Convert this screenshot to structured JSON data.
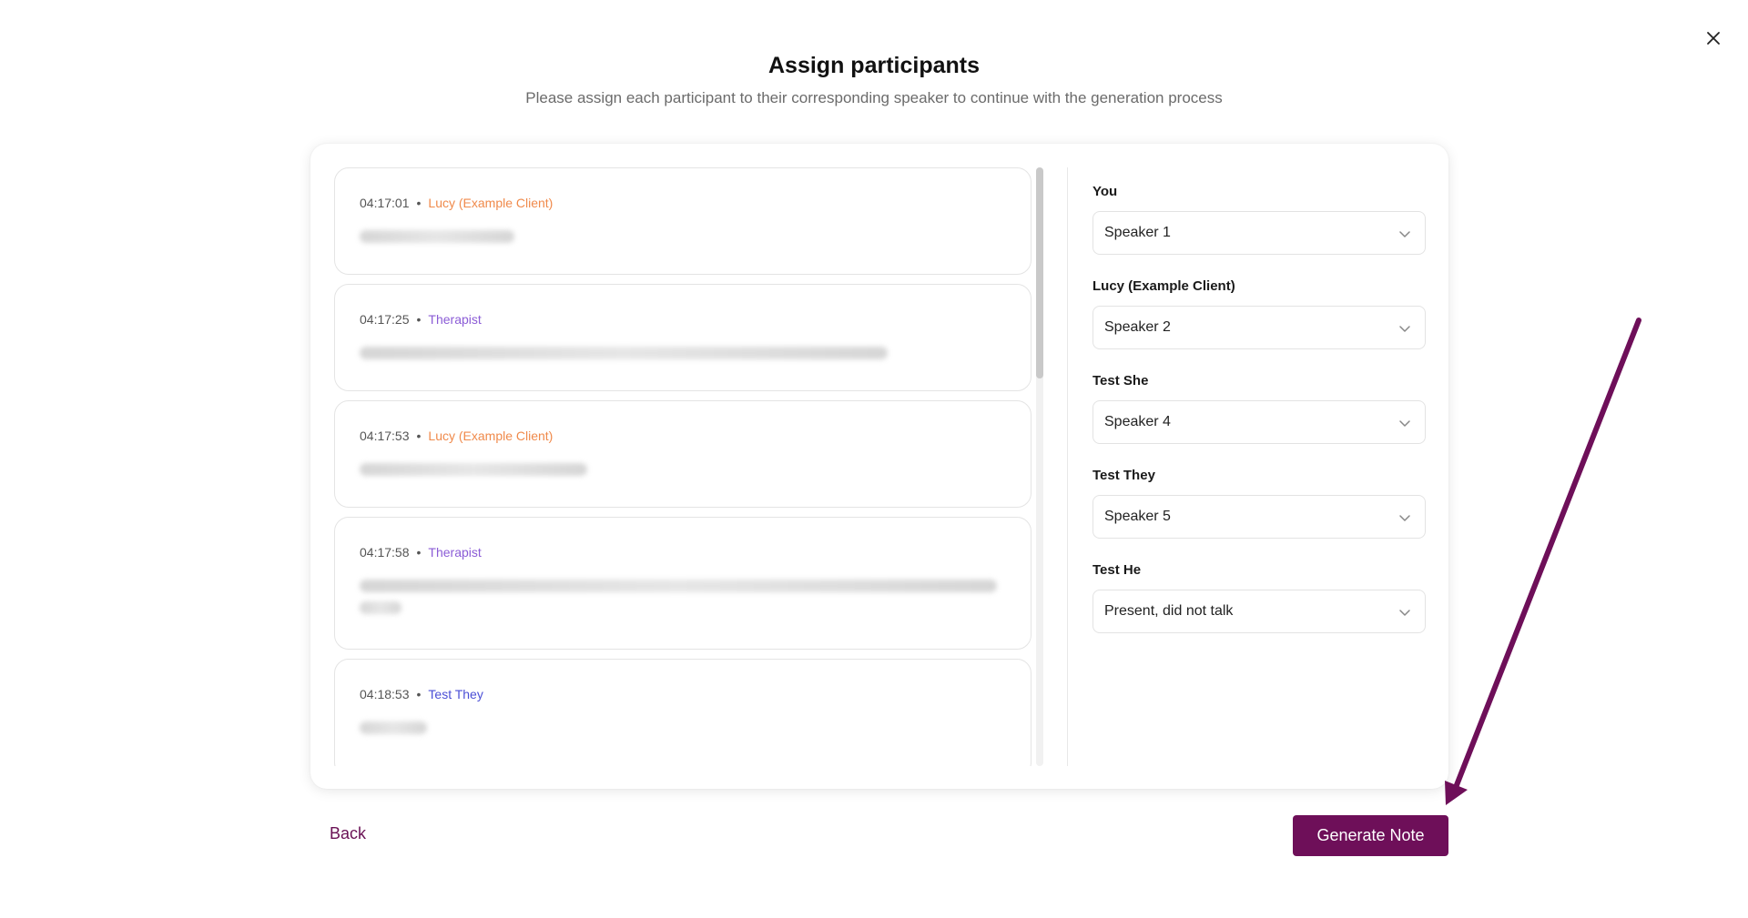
{
  "dialog": {
    "title": "Assign participants",
    "subtitle": "Please assign each participant to their corresponding speaker to continue with the generation process"
  },
  "transcript": {
    "messages": [
      {
        "time": "04:17:01",
        "speaker": "Lucy (Example Client)",
        "speaker_color": "#f08a4b",
        "lines": 1
      },
      {
        "time": "04:17:25",
        "speaker": "Therapist",
        "speaker_color": "#8b5cd6",
        "lines": 1
      },
      {
        "time": "04:17:53",
        "speaker": "Lucy (Example Client)",
        "speaker_color": "#f08a4b",
        "lines": 1
      },
      {
        "time": "04:17:58",
        "speaker": "Therapist",
        "speaker_color": "#8b5cd6",
        "lines": 2
      },
      {
        "time": "04:18:53",
        "speaker": "Test They",
        "speaker_color": "#4b4fd6",
        "lines": 1
      }
    ],
    "separator": "•"
  },
  "assignments": [
    {
      "label": "You",
      "value": "Speaker 1"
    },
    {
      "label": "Lucy (Example Client)",
      "value": "Speaker 2"
    },
    {
      "label": "Test She",
      "value": "Speaker 4"
    },
    {
      "label": "Test They",
      "value": "Speaker 5"
    },
    {
      "label": "Test He",
      "value": "Present, did not talk"
    }
  ],
  "footer": {
    "back_label": "Back",
    "generate_label": "Generate Note"
  },
  "colors": {
    "brand": "#6e0f59",
    "annotation_arrow": "#6e0f59"
  },
  "icons": {
    "close": "close-icon",
    "dropdown": "chevron-down-icon"
  }
}
